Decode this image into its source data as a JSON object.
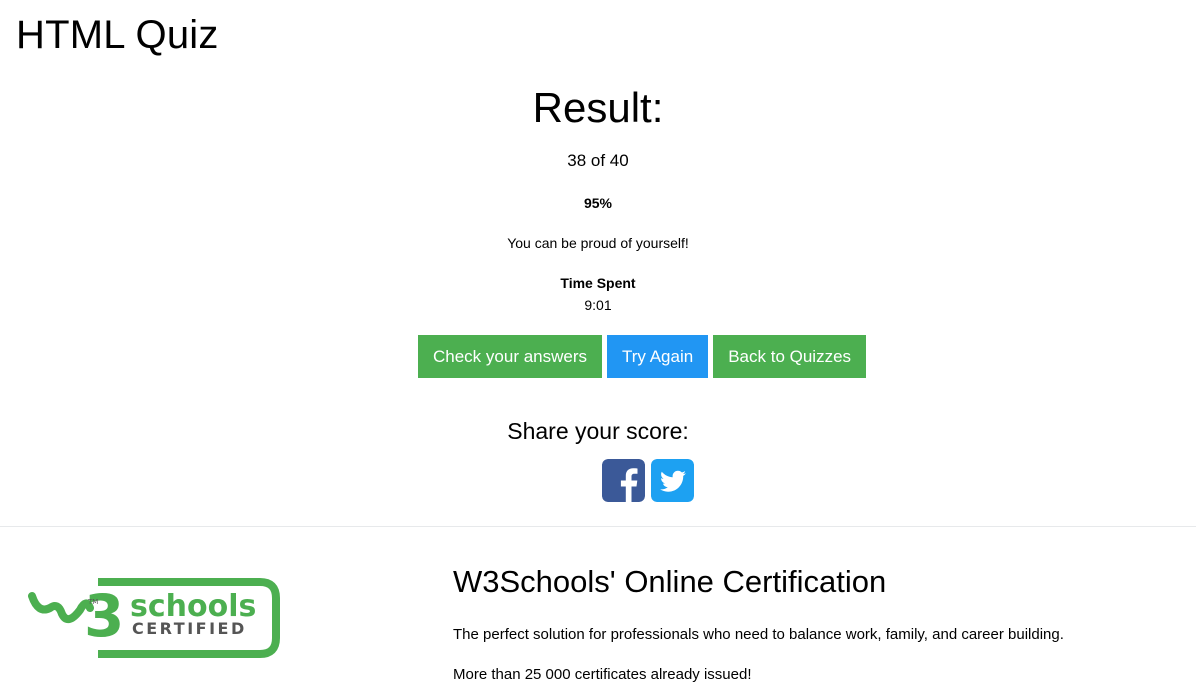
{
  "page": {
    "title": "HTML Quiz"
  },
  "result": {
    "heading": "Result:",
    "score": "38 of 40",
    "percent": "95%",
    "message": "You can be proud of yourself!",
    "time_label": "Time Spent",
    "time_value": "9:01"
  },
  "buttons": {
    "check_answers": "Check your answers",
    "try_again": "Try Again",
    "back_to_quizzes": "Back to Quizzes"
  },
  "share": {
    "label": "Share your score:",
    "icons": [
      "facebook-icon",
      "twitter-icon"
    ]
  },
  "certification": {
    "logo_text": {
      "brand": "schools",
      "mark": "3",
      "sub": "CERTIFIED",
      "tm": "TM"
    },
    "title": "W3Schools' Online Certification",
    "text1": "The perfect solution for professionals who need to balance work, family, and career building.",
    "text2": "More than 25 000 certificates already issued!"
  },
  "colors": {
    "green": "#4caf50",
    "blue": "#2196f3",
    "facebook": "#3b5998",
    "twitter": "#1da1f2",
    "divider": "#e7e9eb",
    "logo_green": "#4caf50",
    "logo_gray": "#555555"
  }
}
